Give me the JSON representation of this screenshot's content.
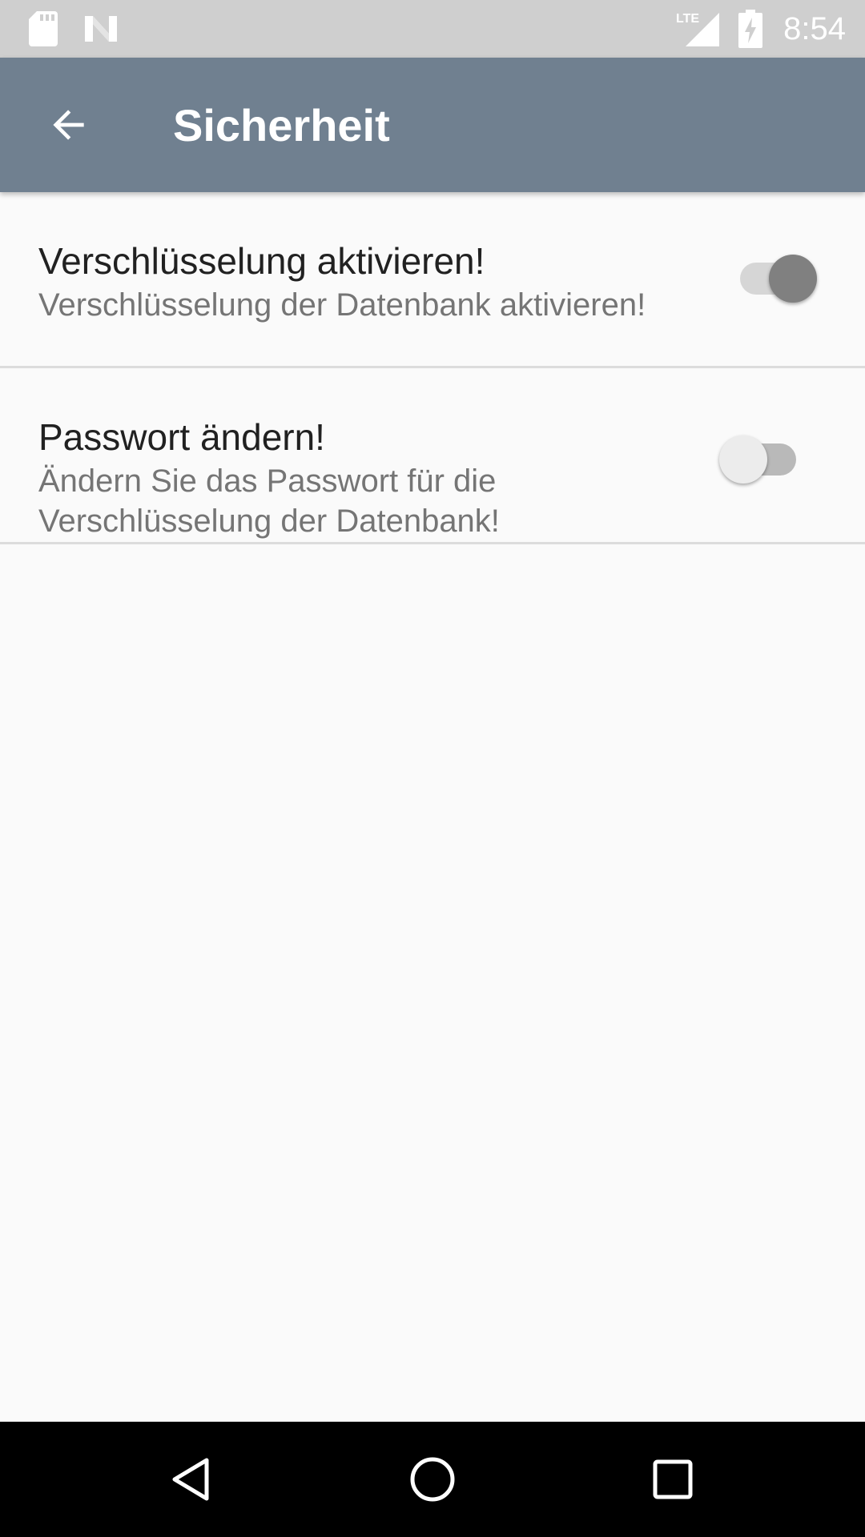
{
  "status_bar": {
    "time": "8:54",
    "icons": [
      "sd-card-icon",
      "n-logo-icon",
      "lte-signal-icon",
      "battery-charging-icon"
    ],
    "network_label": "LTE"
  },
  "app_bar": {
    "title": "Sicherheit",
    "back_icon": "arrow-back-icon",
    "color": "#708090"
  },
  "preferences": [
    {
      "title": "Verschlüsselung aktivieren!",
      "summary": "Verschlüsselung der Datenbank aktivieren!",
      "switch_state": "on"
    },
    {
      "title": "Passwort ändern!",
      "summary": "Ändern Sie das Passwort für die Verschlüsselung der Datenbank!",
      "switch_state": "off"
    }
  ],
  "nav_bar": {
    "buttons": [
      "nav-back-icon",
      "nav-home-icon",
      "nav-recents-icon"
    ]
  }
}
